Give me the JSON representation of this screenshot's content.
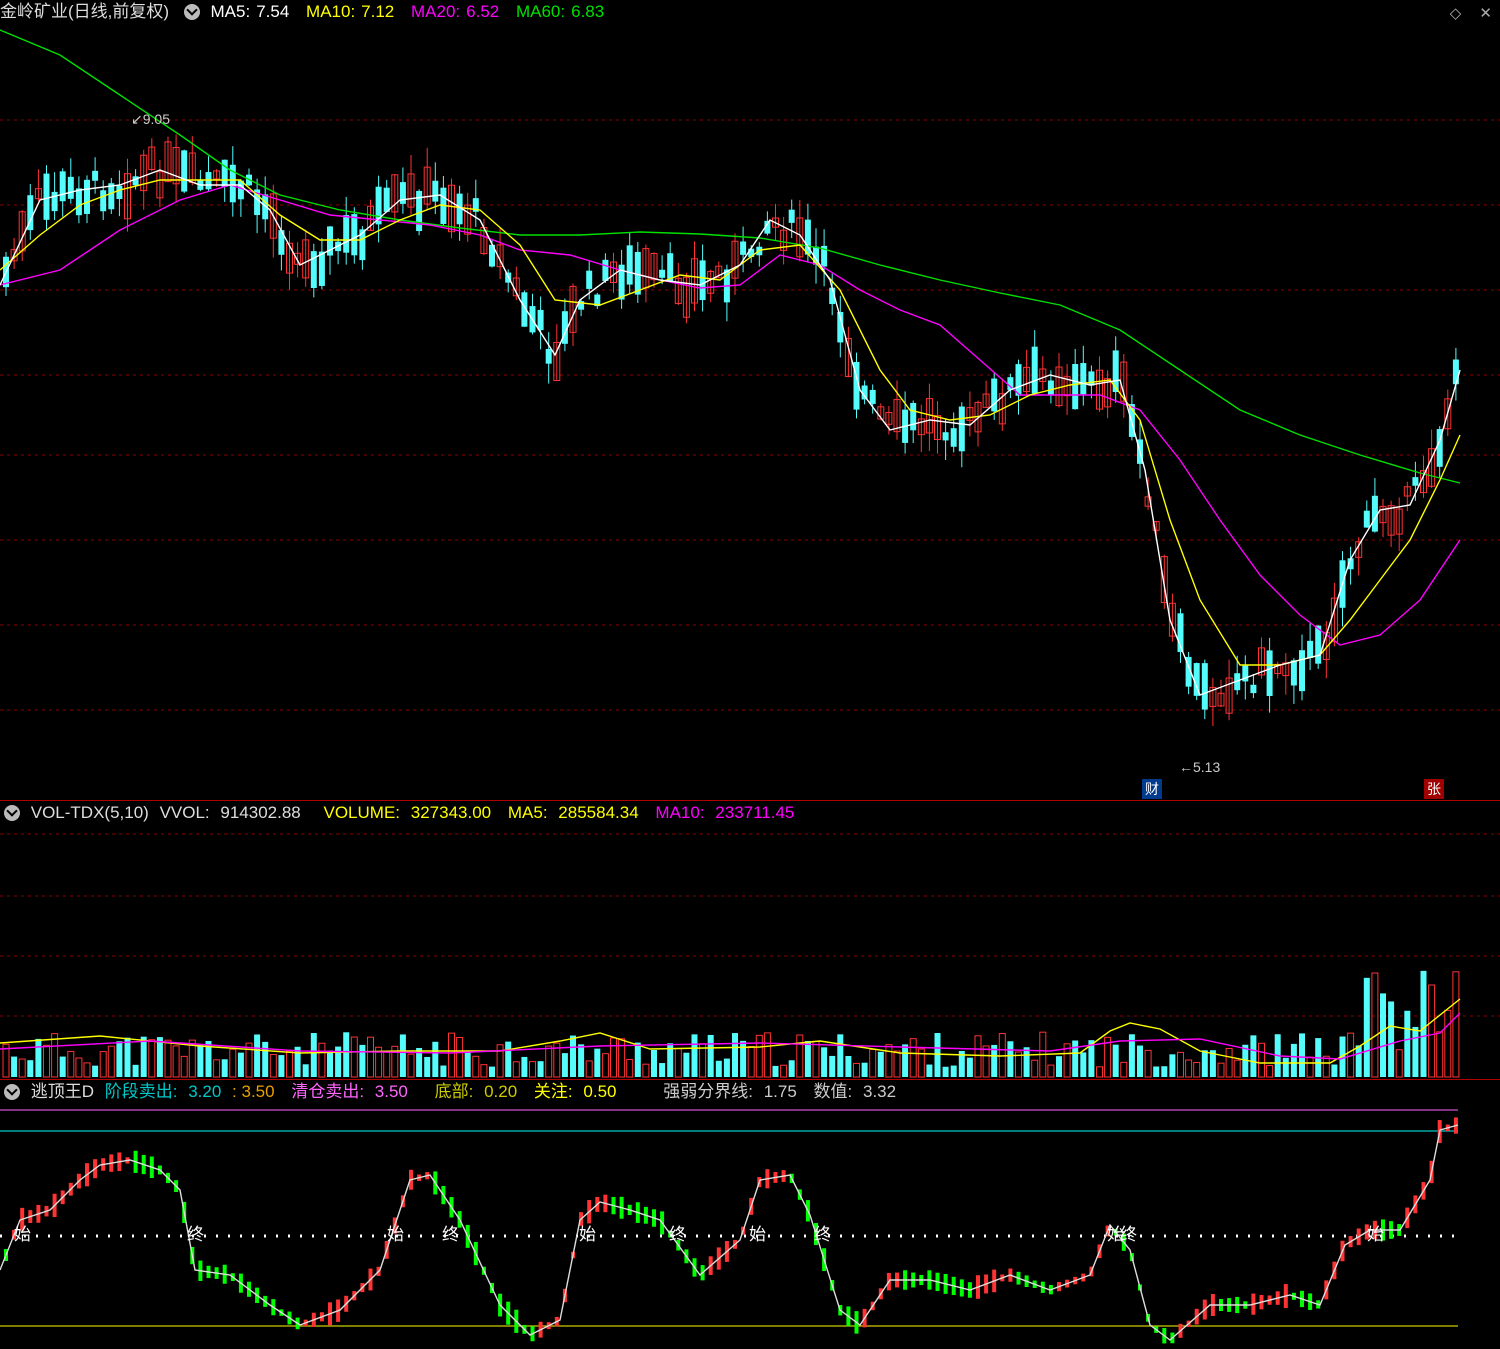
{
  "price_panel": {
    "title": "金岭矿业(日线,前复权)",
    "ma5_label": "MA5:",
    "ma5_value": "7.54",
    "ma10_label": "MA10:",
    "ma10_value": "7.12",
    "ma20_label": "MA20:",
    "ma20_value": "6.52",
    "ma60_label": "MA60:",
    "ma60_value": "6.83",
    "high_marker": "9.05",
    "low_marker": "5.13",
    "tag_cai": "财",
    "tag_zhang": "张",
    "icons": {
      "diamond": "◇",
      "close": "✕"
    }
  },
  "volume_panel": {
    "name": "VOL-TDX(5,10)",
    "vvol_label": "VVOL:",
    "vvol_value": "914302.88",
    "volume_label": "VOLUME:",
    "volume_value": "327343.00",
    "ma5_label": "MA5:",
    "ma5_value": "285584.34",
    "ma10_label": "MA10:",
    "ma10_value": "233711.45"
  },
  "indicator_panel": {
    "name": "逃顶王D",
    "stage_sell_label": "阶段卖出:",
    "stage_sell_v1": "3.20",
    "stage_sell_v2": ": 3.50",
    "clear_sell_label": "清仓卖出:",
    "clear_sell_value": "3.50",
    "bottom_label": "底部:",
    "bottom_value": "0.20",
    "watch_label": "关注:",
    "watch_value": "0.50",
    "divider_label": "强弱分界线:",
    "divider_value": "1.75",
    "numeric_label": "数值:",
    "numeric_value": "3.32",
    "marker_start": "始",
    "marker_end": "终"
  },
  "colors": {
    "up": "#ff3333",
    "down": "#54fcfc",
    "ma5": "#ffffff",
    "ma10": "#ffff00",
    "ma20": "#ff00ff",
    "ma60": "#00e000",
    "grid": "#8b0000",
    "green_bar": "#00ff00",
    "cyan_line": "#00c8c8",
    "yellow_line": "#cccc00",
    "magenta_line": "#d04fd0"
  },
  "chart_data": {
    "type": "candlestick",
    "series": [
      {
        "name": "MA5",
        "values": [
          7.54
        ]
      },
      {
        "name": "MA10",
        "values": [
          7.12
        ]
      },
      {
        "name": "MA20",
        "values": [
          6.52
        ]
      },
      {
        "name": "MA60",
        "values": [
          6.83
        ]
      }
    ],
    "annotations": [
      "9.05",
      "5.13"
    ]
  }
}
